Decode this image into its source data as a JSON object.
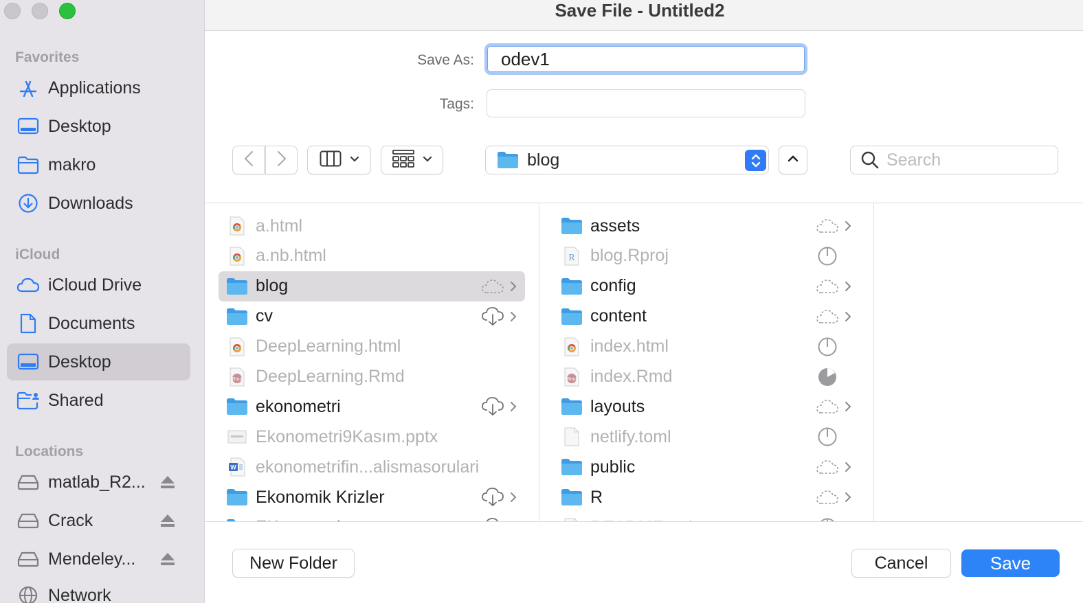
{
  "window": {
    "title": "Save File - Untitled2",
    "traffic_lights": [
      "close",
      "minimize",
      "zoom"
    ]
  },
  "sidebar": {
    "sections": [
      {
        "label": "Favorites"
      },
      {
        "label": "iCloud"
      },
      {
        "label": "Locations"
      }
    ],
    "items": [
      {
        "label": "Applications",
        "icon": "applications-icon",
        "section": "Favorites"
      },
      {
        "label": "Desktop",
        "icon": "desktop-icon",
        "section": "Favorites"
      },
      {
        "label": "makro",
        "icon": "folder-icon",
        "section": "Favorites"
      },
      {
        "label": "Downloads",
        "icon": "downloads-icon",
        "section": "Favorites"
      },
      {
        "label": "iCloud Drive",
        "icon": "cloud-icon",
        "section": "iCloud"
      },
      {
        "label": "Documents",
        "icon": "document-icon",
        "section": "iCloud"
      },
      {
        "label": "Desktop",
        "icon": "desktop-icon",
        "section": "iCloud",
        "selected": true
      },
      {
        "label": "Shared",
        "icon": "shared-folder-icon",
        "section": "iCloud"
      },
      {
        "label": "matlab_R2...",
        "icon": "disk-icon",
        "section": "Locations",
        "eject": true
      },
      {
        "label": "Crack",
        "icon": "disk-icon",
        "section": "Locations",
        "eject": true
      },
      {
        "label": "Mendeley...",
        "icon": "disk-icon",
        "section": "Locations",
        "eject": true
      },
      {
        "label": "Network",
        "icon": "network-icon",
        "section": "Locations"
      }
    ]
  },
  "form": {
    "save_as_label": "Save As:",
    "save_as_value": "odev1",
    "tags_label": "Tags:",
    "tags_value": ""
  },
  "toolbar": {
    "back": "back-chevron-icon",
    "forward": "forward-chevron-icon",
    "view_mode": "column-view-icon",
    "group_mode": "grid-view-icon",
    "path_label": "blog",
    "search_placeholder": "Search"
  },
  "columns": [
    {
      "items": [
        {
          "label": "a.html",
          "icon": "chrome-html-icon",
          "dim": true
        },
        {
          "label": "a.nb.html",
          "icon": "chrome-html-icon",
          "dim": true
        },
        {
          "label": "blog",
          "icon": "folder-icon",
          "status": "cloud-dashed-icon",
          "chevron": true,
          "selected": true
        },
        {
          "label": "cv",
          "icon": "folder-icon",
          "status": "cloud-download-icon",
          "chevron": true
        },
        {
          "label": "DeepLearning.html",
          "icon": "chrome-html-icon",
          "dim": true
        },
        {
          "label": "DeepLearning.Rmd",
          "icon": "rmd-icon",
          "dim": true
        },
        {
          "label": "ekonometri",
          "icon": "folder-icon",
          "status": "cloud-download-icon",
          "chevron": true
        },
        {
          "label": "Ekonometri9Kasım.pptx",
          "icon": "pptx-icon",
          "dim": true
        },
        {
          "label": "ekonometrifin...alismasorulari",
          "icon": "word-icon",
          "dim": true
        },
        {
          "label": "Ekonomik Krizler",
          "icon": "folder-icon",
          "status": "cloud-download-icon",
          "chevron": true
        },
        {
          "label": "EKonomod...",
          "icon": "folder-icon",
          "status": "cloud-download-icon",
          "chevron": true
        }
      ]
    },
    {
      "items": [
        {
          "label": "assets",
          "icon": "folder-icon",
          "status": "cloud-dashed-icon",
          "chevron": true
        },
        {
          "label": "blog.Rproj",
          "icon": "rproj-icon",
          "status": "progress-empty-icon",
          "dim": true
        },
        {
          "label": "config",
          "icon": "folder-icon",
          "status": "cloud-dashed-icon",
          "chevron": true
        },
        {
          "label": "content",
          "icon": "folder-icon",
          "status": "cloud-dashed-icon",
          "chevron": true
        },
        {
          "label": "index.html",
          "icon": "chrome-html-icon",
          "status": "progress-empty-icon",
          "dim": true
        },
        {
          "label": "index.Rmd",
          "icon": "rmd-icon",
          "status": "progress-filled-icon",
          "dim": true
        },
        {
          "label": "layouts",
          "icon": "folder-icon",
          "status": "cloud-dashed-icon",
          "chevron": true
        },
        {
          "label": "netlify.toml",
          "icon": "blank-file-icon",
          "status": "progress-empty-icon",
          "dim": true
        },
        {
          "label": "public",
          "icon": "folder-icon",
          "status": "cloud-dashed-icon",
          "chevron": true
        },
        {
          "label": "R",
          "icon": "folder-icon",
          "status": "cloud-dashed-icon",
          "chevron": true
        },
        {
          "label": "README.md",
          "icon": "blank-file-icon",
          "status": "progress-empty-icon",
          "dim": true
        }
      ]
    }
  ],
  "buttons": {
    "new_folder": "New Folder",
    "cancel": "Cancel",
    "save": "Save"
  },
  "colors": {
    "accent": "#2d84f7",
    "sidebar_bg": "#e7e4e9",
    "folder_blue": "#4ea8e8",
    "selected_row": "#dcdadd"
  }
}
